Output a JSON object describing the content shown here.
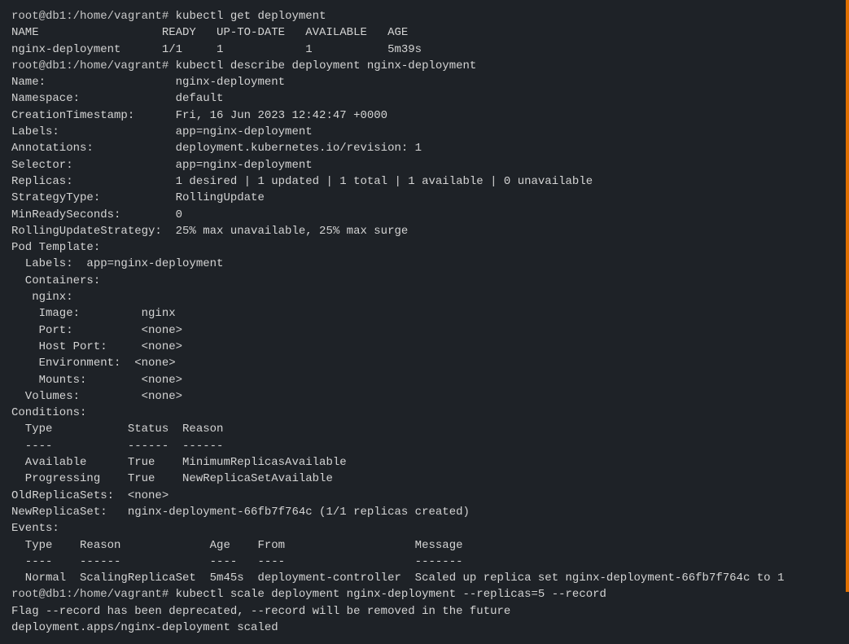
{
  "terminal": {
    "lines": [
      {
        "type": "prompt",
        "text": "root@db1:/home/vagrant# kubectl get deployment"
      },
      {
        "type": "output",
        "text": "NAME                  READY   UP-TO-DATE   AVAILABLE   AGE"
      },
      {
        "type": "output",
        "text": "nginx-deployment      1/1     1            1           5m39s"
      },
      {
        "type": "prompt",
        "text": "root@db1:/home/vagrant# kubectl describe deployment nginx-deployment"
      },
      {
        "type": "output",
        "text": "Name:                   nginx-deployment"
      },
      {
        "type": "output",
        "text": "Namespace:              default"
      },
      {
        "type": "output",
        "text": "CreationTimestamp:      Fri, 16 Jun 2023 12:42:47 +0000"
      },
      {
        "type": "output",
        "text": "Labels:                 app=nginx-deployment"
      },
      {
        "type": "output",
        "text": "Annotations:            deployment.kubernetes.io/revision: 1"
      },
      {
        "type": "output",
        "text": "Selector:               app=nginx-deployment"
      },
      {
        "type": "output",
        "text": "Replicas:               1 desired | 1 updated | 1 total | 1 available | 0 unavailable"
      },
      {
        "type": "output",
        "text": "StrategyType:           RollingUpdate"
      },
      {
        "type": "output",
        "text": "MinReadySeconds:        0"
      },
      {
        "type": "output",
        "text": "RollingUpdateStrategy:  25% max unavailable, 25% max surge"
      },
      {
        "type": "output",
        "text": "Pod Template:"
      },
      {
        "type": "output",
        "text": "  Labels:  app=nginx-deployment"
      },
      {
        "type": "output",
        "text": "  Containers:"
      },
      {
        "type": "output",
        "text": "   nginx:"
      },
      {
        "type": "output",
        "text": "    Image:         nginx"
      },
      {
        "type": "output",
        "text": "    Port:          <none>"
      },
      {
        "type": "output",
        "text": "    Host Port:     <none>"
      },
      {
        "type": "output",
        "text": "    Environment:  <none>"
      },
      {
        "type": "output",
        "text": "    Mounts:        <none>"
      },
      {
        "type": "output",
        "text": "  Volumes:         <none>"
      },
      {
        "type": "output",
        "text": "Conditions:"
      },
      {
        "type": "output",
        "text": "  Type           Status  Reason"
      },
      {
        "type": "output",
        "text": "  ----           ------  ------"
      },
      {
        "type": "output",
        "text": "  Available      True    MinimumReplicasAvailable"
      },
      {
        "type": "output",
        "text": "  Progressing    True    NewReplicaSetAvailable"
      },
      {
        "type": "output",
        "text": "OldReplicaSets:  <none>"
      },
      {
        "type": "output",
        "text": "NewReplicaSet:   nginx-deployment-66fb7f764c (1/1 replicas created)"
      },
      {
        "type": "output",
        "text": "Events:"
      },
      {
        "type": "output",
        "text": "  Type    Reason             Age    From                   Message"
      },
      {
        "type": "output",
        "text": "  ----    ------             ----   ----                   -------"
      },
      {
        "type": "output",
        "text": "  Normal  ScalingReplicaSet  5m45s  deployment-controller  Scaled up replica set nginx-deployment-66fb7f764c to 1"
      },
      {
        "type": "prompt",
        "text": "root@db1:/home/vagrant# kubectl scale deployment nginx-deployment --replicas=5 --record"
      },
      {
        "type": "output",
        "text": "Flag --record has been deprecated, --record will be removed in the future"
      },
      {
        "type": "output",
        "text": "deployment.apps/nginx-deployment scaled"
      }
    ]
  }
}
